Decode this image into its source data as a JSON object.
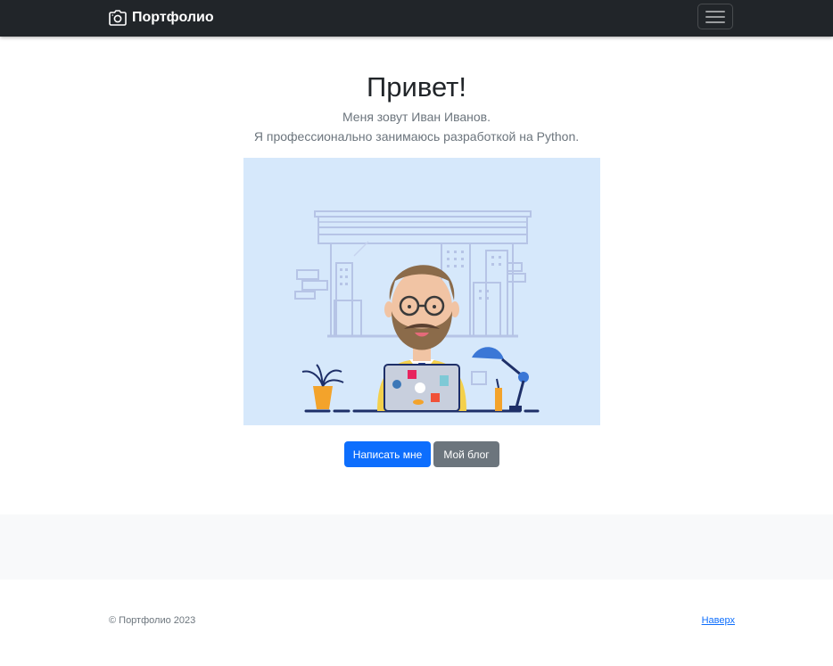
{
  "navbar": {
    "brand_text": "Портфолио",
    "brand_icon": "camera-icon",
    "toggler_icon": "hamburger-menu-icon"
  },
  "hero": {
    "title": "Привет!",
    "lead_line1": "Меня зовут Иван Иванов.",
    "lead_line2": "Я профессионально занимаюсь разработкой на Python.",
    "illustration": "developer-at-laptop-illustration",
    "primary_button": "Написать мне",
    "secondary_button": "Мой блог"
  },
  "footer": {
    "copyright": "© Портфолио 2023",
    "back_to_top": "Наверх"
  },
  "colors": {
    "navbar_bg": "#212529",
    "primary": "#0d6efd",
    "secondary": "#6c757d",
    "illustration_bg": "#d6e8fb",
    "band_bg": "#f8f9fa"
  }
}
